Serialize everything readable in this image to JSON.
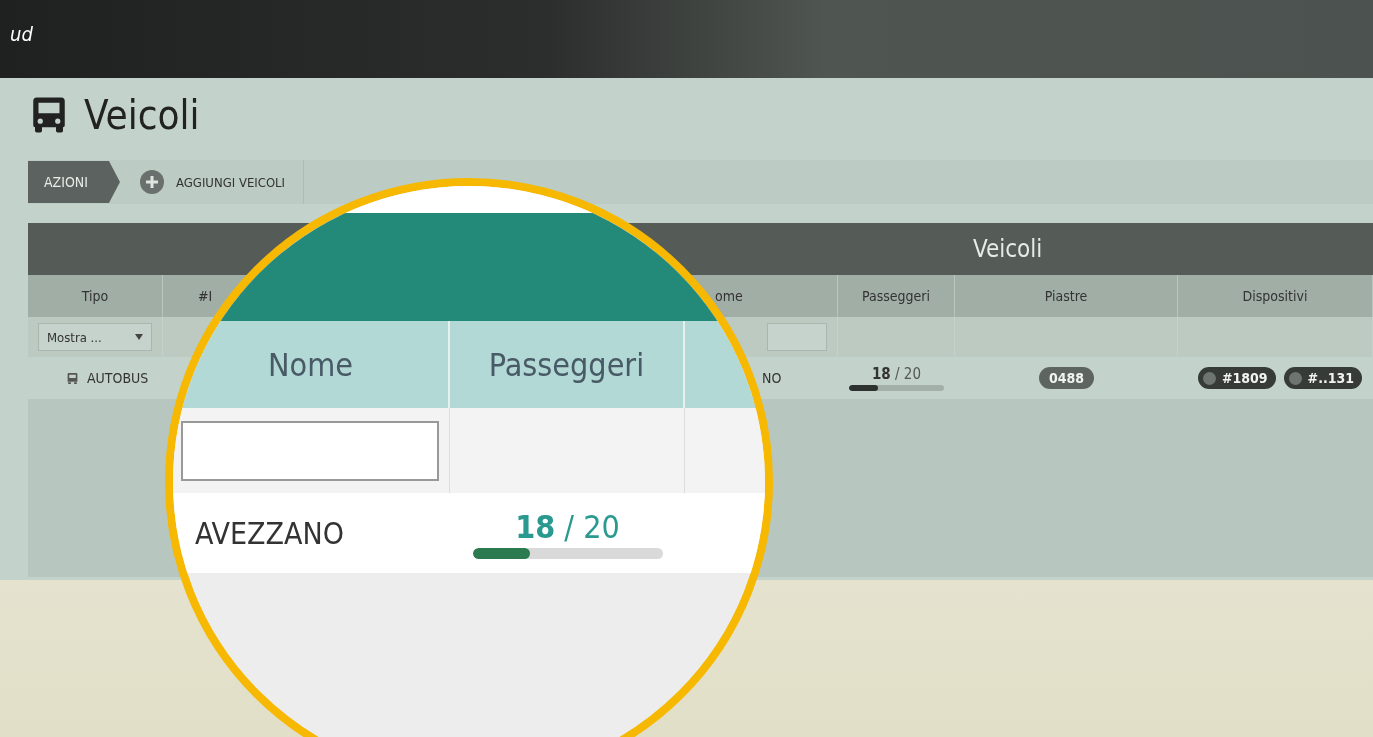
{
  "topbar": {
    "logo": "ud"
  },
  "page": {
    "title": "Veicoli"
  },
  "toolbar": {
    "label": "AZIONI",
    "actions": [
      {
        "label": "AGGIUNGI VEICOLI"
      }
    ]
  },
  "table": {
    "title": "Veicoli",
    "columns": [
      {
        "label": "Tipo"
      },
      {
        "label": "#I"
      },
      {
        "label": "ome"
      },
      {
        "label": "Passeggeri"
      },
      {
        "label": "Piastre"
      },
      {
        "label": "Dispositivi"
      }
    ],
    "filters": {
      "tipo": "Mostra ..."
    },
    "rows": [
      {
        "tipo": "AUTOBUS",
        "nome": "NO",
        "passengers": "**18** / 20",
        "level": 0.3,
        "plates": [
          "0488"
        ],
        "devices": [
          "#1809",
          "#..131"
        ]
      }
    ]
  },
  "magnifier": {
    "columns": [
      {
        "label": "Nome"
      },
      {
        "label": "Passeggeri"
      }
    ],
    "row": {
      "nome": "AVEZZANO",
      "passengers": "**18** / 20",
      "level": 0.3
    }
  }
}
